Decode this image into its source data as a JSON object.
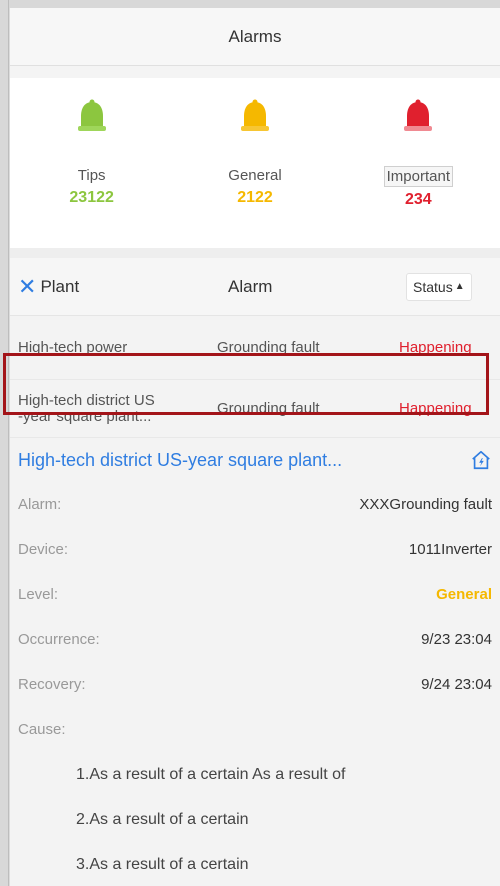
{
  "header": {
    "title": "Alarms"
  },
  "summary": {
    "levels": [
      {
        "label": "Tips",
        "count": "23122",
        "color": "#8cc63f"
      },
      {
        "label": "General",
        "count": "2122",
        "color": "#f5b800"
      },
      {
        "label": "Important",
        "count": "234",
        "color": "#e0202e"
      }
    ]
  },
  "table": {
    "headers": {
      "plant": "Plant",
      "alarm": "Alarm",
      "status": "Status"
    },
    "rows": [
      {
        "plant": "High-tech power",
        "alarm": "Grounding fault",
        "status": "Happening"
      },
      {
        "plant_line1": "High-tech district US",
        "plant_line2": "-year square plant...",
        "alarm": "Grounding fault",
        "status": "Happening"
      }
    ]
  },
  "detail": {
    "title": "High-tech district US-year square plant...",
    "fields": [
      {
        "key": "Alarm:",
        "value": "XXXGrounding fault"
      },
      {
        "key": "Device:",
        "value": "1011Inverter"
      },
      {
        "key": "Level:",
        "value": "General"
      },
      {
        "key": "Occurrence:",
        "value": "9/23  23:04"
      },
      {
        "key": "Recovery:",
        "value": "9/24  23:04"
      }
    ],
    "cause_label": "Cause:",
    "causes": [
      "1.As a result of a certain As a result of",
      "2.As a result of a certain",
      "3.As a result of a certain"
    ]
  },
  "icons": {
    "bell": "bell-icon",
    "close": "close-icon",
    "sort": "triangle-up-icon",
    "home": "home-icon"
  }
}
